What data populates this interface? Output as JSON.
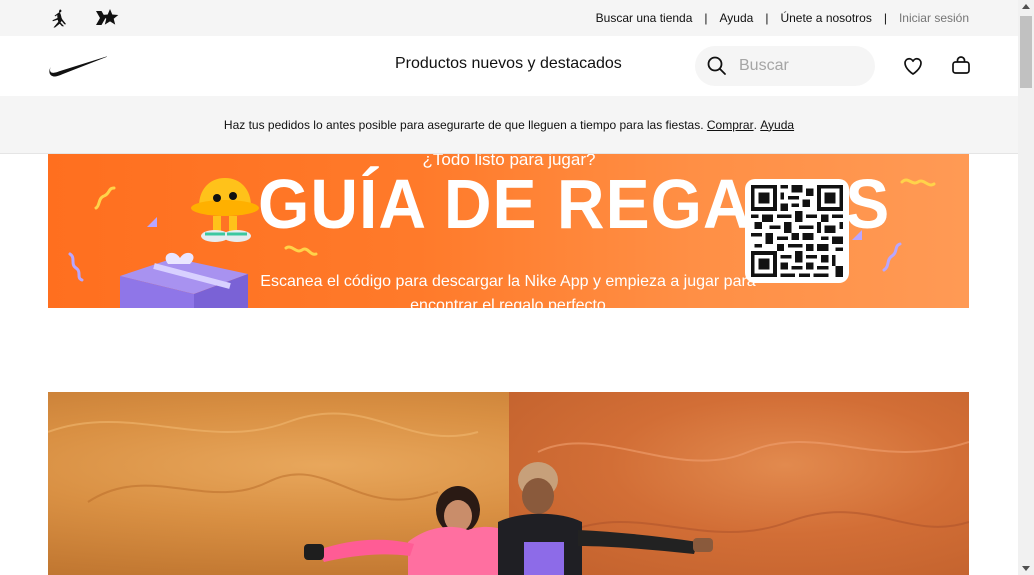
{
  "utility": {
    "links": [
      "Buscar una tienda",
      "Ayuda",
      "Únete a nosotros"
    ],
    "signin": "Iniciar sesión",
    "separator": "|",
    "brands": [
      "jordan-icon",
      "converse-icon"
    ]
  },
  "nav": {
    "menu_item": "Productos nuevos y destacados",
    "search_placeholder": "Buscar",
    "icons": [
      "nike-swoosh-icon",
      "search-icon",
      "heart-icon",
      "bag-icon"
    ]
  },
  "promo": {
    "text": "Haz tus pedidos lo antes posible para asegurarte de que lleguen a tiempo para las fiestas.",
    "link_buy": "Comprar",
    "period": ".",
    "link_help": "Ayuda"
  },
  "gift_banner": {
    "kicker": "¿Todo listo para jugar?",
    "title": "GUÍA DE REGALOS",
    "body": "Escanea el código para descargar la Nike App y empieza a jugar para encontrar el regalo perfecto",
    "colors": {
      "background": "#ff7a2a",
      "text": "#ffffff"
    }
  },
  "colors": {
    "utility_bg": "#f5f5f5",
    "text": "#111111",
    "muted": "#757575"
  }
}
